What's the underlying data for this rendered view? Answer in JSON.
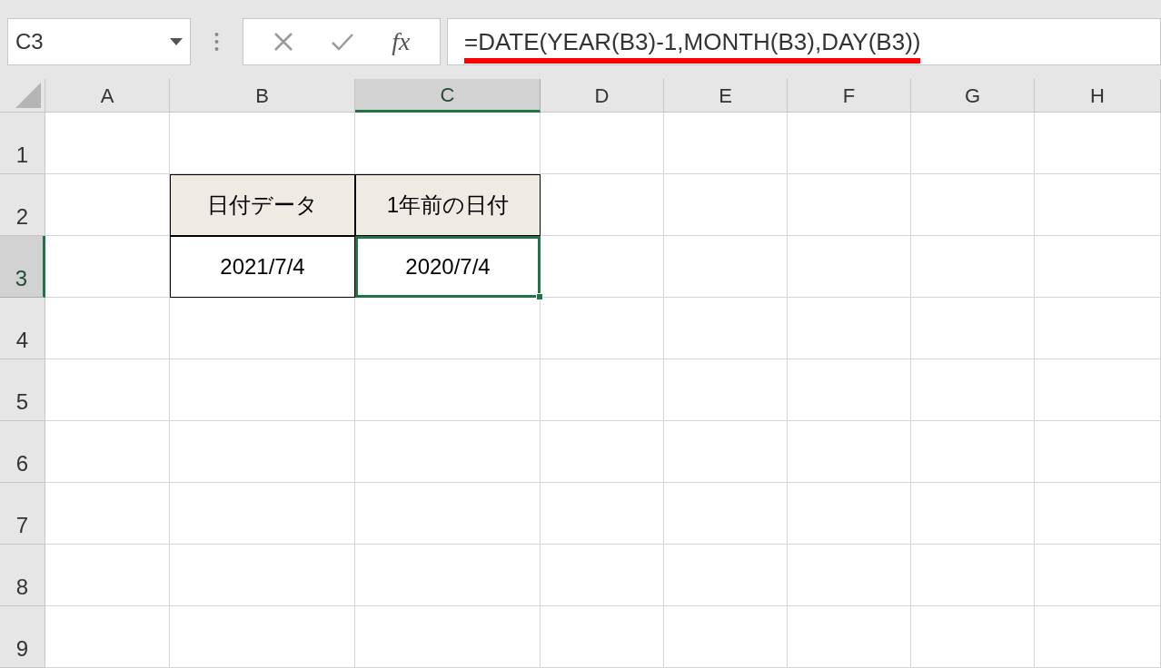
{
  "name_box": {
    "value": "C3"
  },
  "formula_bar": {
    "function_label": "fx",
    "formula": "=DATE(YEAR(B3)-1,MONTH(B3),DAY(B3))",
    "underlined": true
  },
  "columns": [
    {
      "label": "A",
      "selected": false
    },
    {
      "label": "B",
      "selected": false
    },
    {
      "label": "C",
      "selected": true
    },
    {
      "label": "D",
      "selected": false
    },
    {
      "label": "E",
      "selected": false
    },
    {
      "label": "F",
      "selected": false
    },
    {
      "label": "G",
      "selected": false
    },
    {
      "label": "H",
      "selected": false
    }
  ],
  "rows": [
    {
      "label": "1",
      "selected": false
    },
    {
      "label": "2",
      "selected": false
    },
    {
      "label": "3",
      "selected": true
    },
    {
      "label": "4",
      "selected": false
    },
    {
      "label": "5",
      "selected": false
    },
    {
      "label": "6",
      "selected": false
    },
    {
      "label": "7",
      "selected": false
    },
    {
      "label": "8",
      "selected": false
    },
    {
      "label": "9",
      "selected": false
    }
  ],
  "table": {
    "header": [
      "日付データ",
      "1年前の日付"
    ],
    "rows": [
      [
        {
          "text": "2021/7/4",
          "selected": false
        },
        {
          "text": "2020/7/4",
          "selected": true
        }
      ]
    ]
  }
}
